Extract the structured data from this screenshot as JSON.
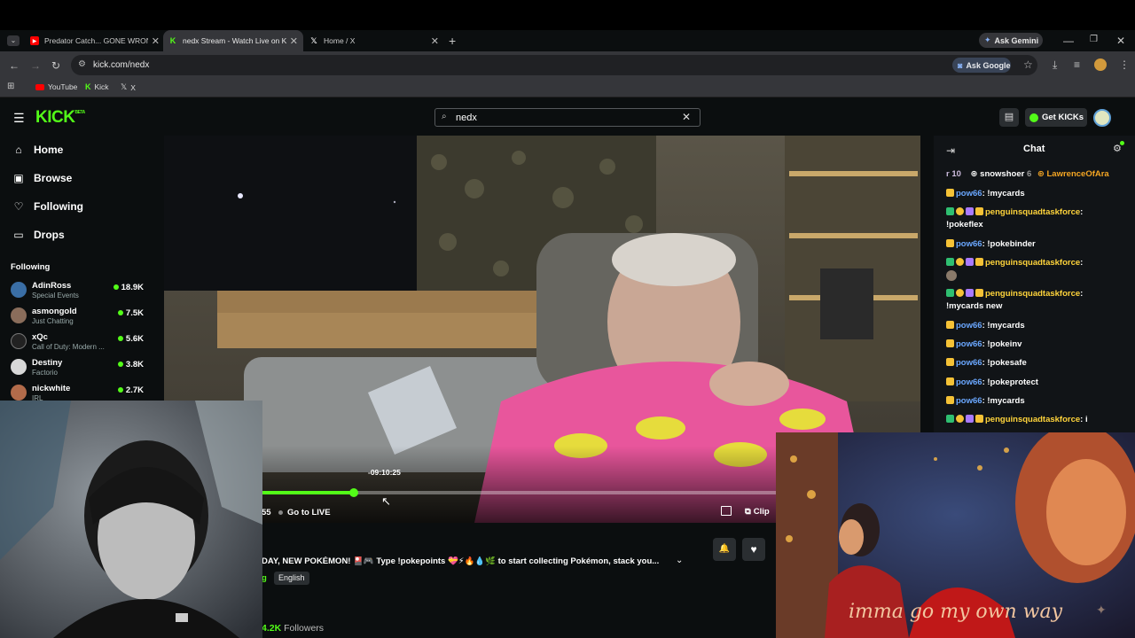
{
  "browser": {
    "tabs": [
      {
        "title": "Predator Catch... GONE WRONG",
        "icon": "youtube-icon"
      },
      {
        "title": "nedx Stream - Watch Live on Kick",
        "icon": "kick-icon"
      },
      {
        "title": "Home / X",
        "icon": "x-icon"
      }
    ],
    "new_tab": "+",
    "ask_gemini": "Ask Gemini",
    "url": "kick.com/nedx",
    "ask_google": "Ask Google",
    "bookmarks": [
      {
        "label": "YouTube",
        "icon": "youtube-icon"
      },
      {
        "label": "Kick",
        "icon": "kick-icon"
      },
      {
        "label": "X",
        "icon": "x-icon"
      }
    ]
  },
  "kick": {
    "logo": "KICK",
    "logo_tag": "BETA",
    "search_value": "nedx",
    "get_kicks": "Get KICKs"
  },
  "sidebar": {
    "nav": [
      {
        "label": "Home",
        "icon": "home-icon"
      },
      {
        "label": "Browse",
        "icon": "browse-icon"
      },
      {
        "label": "Following",
        "icon": "heart-icon"
      },
      {
        "label": "Drops",
        "icon": "drops-icon"
      }
    ],
    "following_title": "Following",
    "following": [
      {
        "name": "AdinRoss",
        "category": "Special Events",
        "viewers": "18.9K"
      },
      {
        "name": "asmongold",
        "category": "Just Chatting",
        "viewers": "7.5K"
      },
      {
        "name": "xQc",
        "category": "Call of Duty: Modern ...",
        "viewers": "5.6K"
      },
      {
        "name": "Destiny",
        "category": "Factorio",
        "viewers": "3.8K"
      },
      {
        "name": "nickwhite",
        "category": "IRL",
        "viewers": "2.7K"
      }
    ]
  },
  "player": {
    "hover_time": "-09:10:25",
    "time_fragment": "55",
    "go_live": "Go to LIVE",
    "clip": "Clip",
    "progress": 0.18
  },
  "stream_info": {
    "title": "DAY, NEW POKÉMON! 🎴🎮 Type !pokepoints 💝⚡🔥💧🌿 to start collecting Pokémon, stack you...",
    "tag_fragment": "g",
    "language": "English",
    "followers_count": "4.2K",
    "followers_label": "Followers"
  },
  "chat": {
    "title": "Chat",
    "top": [
      {
        "text": "r 10"
      },
      {
        "name": "snowshoer",
        "count": "6"
      },
      {
        "name": "LawrenceOfAra"
      }
    ],
    "messages": [
      {
        "user": "pow66",
        "text": "!mycards"
      },
      {
        "user": "penguinsquadtaskforce",
        "text": "!pokeflex"
      },
      {
        "user": "pow66",
        "text": "!pokebinder"
      },
      {
        "user": "penguinsquadtaskforce",
        "text": ""
      },
      {
        "user": "penguinsquadtaskforce",
        "text": "!mycards new"
      },
      {
        "user": "pow66",
        "text": "!mycards"
      },
      {
        "user": "pow66",
        "text": "!pokeinv"
      },
      {
        "user": "pow66",
        "text": "!pokesafe"
      },
      {
        "user": "pow66",
        "text": "!pokeprotect"
      },
      {
        "user": "pow66",
        "text": "!mycards"
      },
      {
        "user": "penguinsquadtaskforce",
        "text": "i"
      }
    ]
  },
  "overlay": {
    "art_caption": "imma go my own way"
  },
  "colors": {
    "kick_green": "#53fc18",
    "chat_blue": "#6aa7ff",
    "chat_gold": "#ffd43b"
  }
}
